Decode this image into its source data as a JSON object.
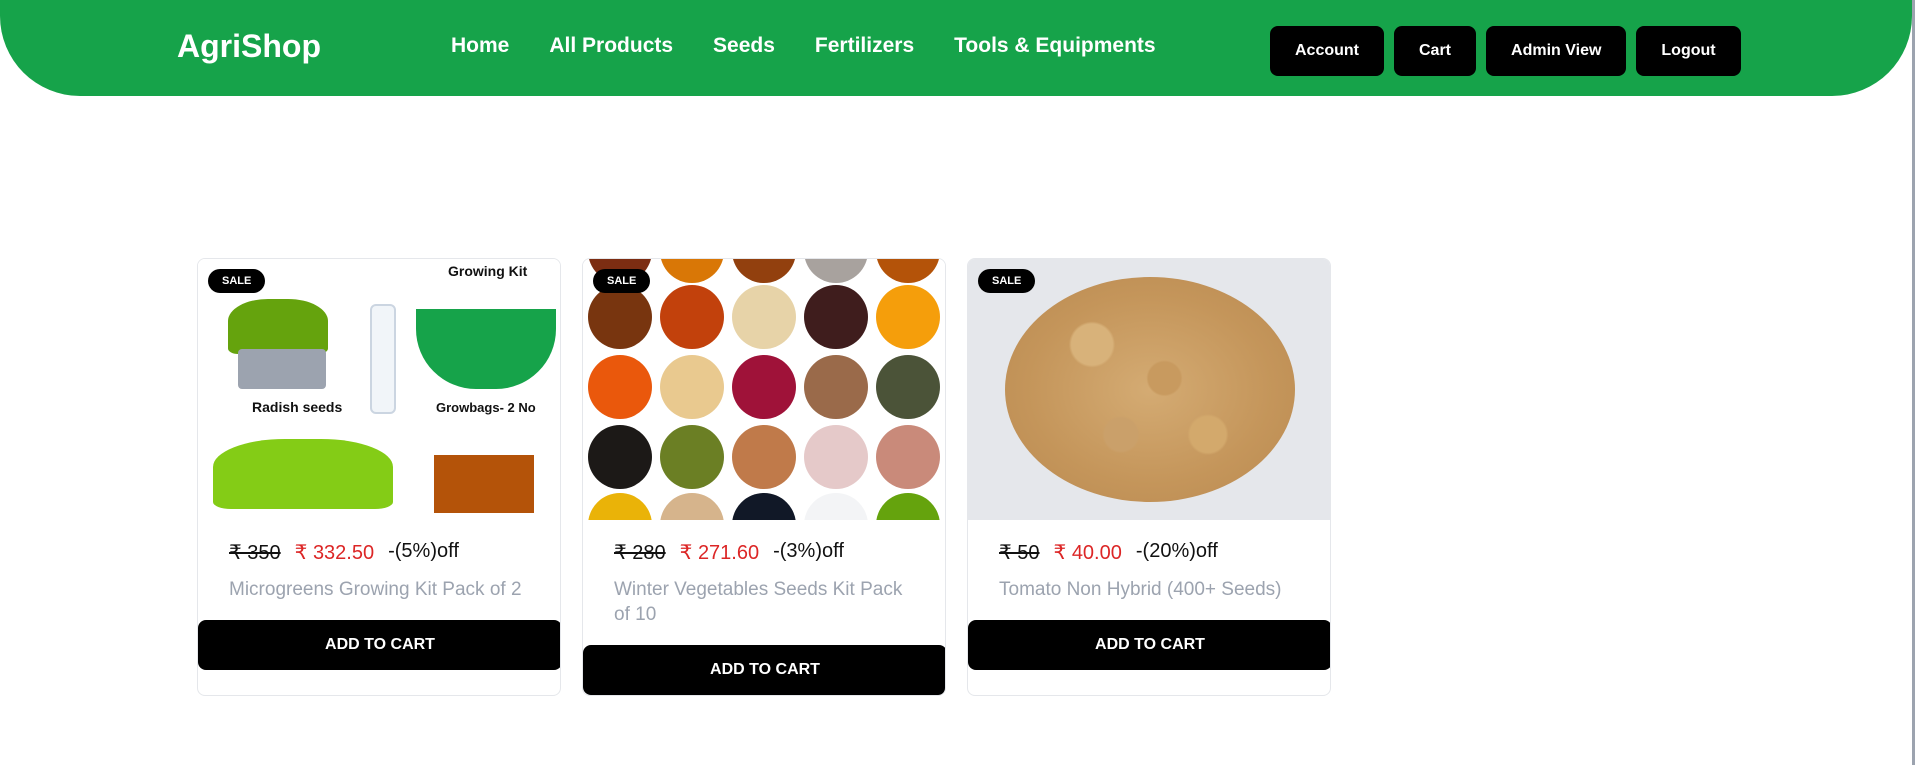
{
  "header": {
    "brand": "AgriShop",
    "nav": [
      "Home",
      "All Products",
      "Seeds",
      "Fertilizers",
      "Tools & Equipments"
    ],
    "actions": [
      "Account",
      "Cart",
      "Admin View",
      "Logout"
    ],
    "color": "#16a34a"
  },
  "products": [
    {
      "badge": "SALE",
      "old_price": "₹ 350",
      "new_price": "₹ 332.50",
      "discount": "-(5%)off",
      "title": "Microgreens Growing Kit Pack of 2",
      "cta": "ADD TO CART",
      "image_labels": {
        "top": "Growing Kit",
        "seeds": "Radish seeds",
        "bags": "Growbags- 2 No"
      }
    },
    {
      "badge": "SALE",
      "old_price": "₹ 280",
      "new_price": "₹ 271.60",
      "discount": "-(3%)off",
      "title": "Winter Vegetables Seeds Kit Pack of 10",
      "cta": "ADD TO CART"
    },
    {
      "badge": "SALE",
      "old_price": "₹ 50",
      "new_price": "₹ 40.00",
      "discount": "-(20%)off",
      "title": "Tomato Non Hybrid (400+ Seeds)",
      "cta": "ADD TO CART"
    }
  ],
  "colors": {
    "accent": "#16a34a",
    "price": "#dc2626",
    "muted": "#9ca3af"
  }
}
